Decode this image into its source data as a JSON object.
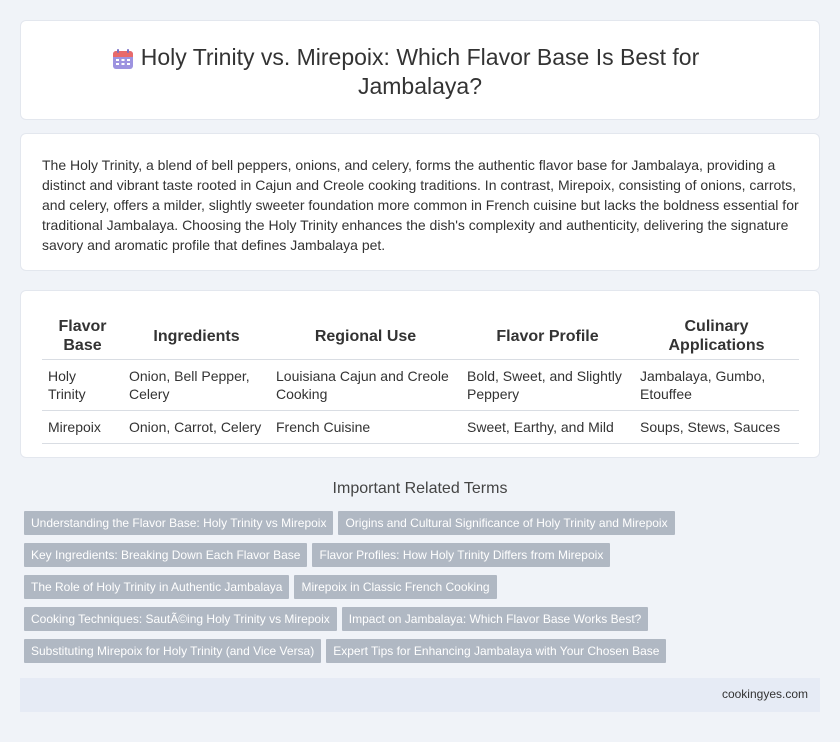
{
  "header": {
    "title": "Holy Trinity vs. Mirepoix: Which Flavor Base Is Best for Jambalaya?",
    "icon": "calendar-icon"
  },
  "intro": {
    "text": "The Holy Trinity, a blend of bell peppers, onions, and celery, forms the authentic flavor base for Jambalaya, providing a distinct and vibrant taste rooted in Cajun and Creole cooking traditions. In contrast, Mirepoix, consisting of onions, carrots, and celery, offers a milder, slightly sweeter foundation more common in French cuisine but lacks the boldness essential for traditional Jambalaya. Choosing the Holy Trinity enhances the dish's complexity and authenticity, delivering the signature savory and aromatic profile that defines Jambalaya pet."
  },
  "table": {
    "headers": [
      "Flavor Base",
      "Ingredients",
      "Regional Use",
      "Flavor Profile",
      "Culinary Applications"
    ],
    "rows": [
      [
        "Holy Trinity",
        "Onion, Bell Pepper, Celery",
        "Louisiana Cajun and Creole Cooking",
        "Bold, Sweet, and Slightly Peppery",
        "Jambalaya, Gumbo, Etouffee"
      ],
      [
        "Mirepoix",
        "Onion, Carrot, Celery",
        "French Cuisine",
        "Sweet, Earthy, and Mild",
        "Soups, Stews, Sauces"
      ]
    ]
  },
  "related": {
    "title": "Important Related Terms",
    "tags": [
      [
        "Understanding the Flavor Base: Holy Trinity vs Mirepoix",
        "Origins and Cultural Significance of Holy Trinity and Mirepoix"
      ],
      [
        "Key Ingredients: Breaking Down Each Flavor Base",
        "Flavor Profiles: How Holy Trinity Differs from Mirepoix"
      ],
      [
        "The Role of Holy Trinity in Authentic Jambalaya",
        "Mirepoix in Classic French Cooking"
      ],
      [
        "Cooking Techniques: SautÃ©ing Holy Trinity vs Mirepoix",
        "Impact on Jambalaya: Which Flavor Base Works Best?"
      ],
      [
        "Substituting Mirepoix for Holy Trinity (and Vice Versa)",
        "Expert Tips for Enhancing Jambalaya with Your Chosen Base"
      ]
    ]
  },
  "footer": {
    "site": "cookingyes.com"
  },
  "colors": {
    "background": "#f0f3f8",
    "tag_bg": "#b0b8c3",
    "footer_bg": "#e6ebf5",
    "icon_purple": "#8b7fd6",
    "icon_red": "#e86a6a"
  }
}
